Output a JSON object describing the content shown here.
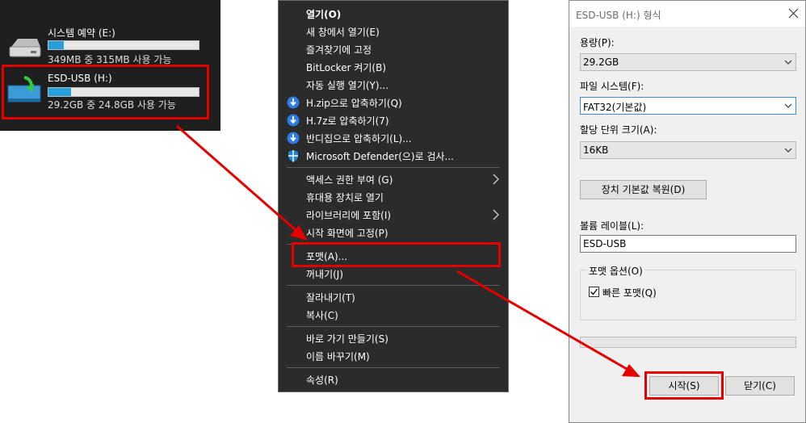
{
  "drives": [
    {
      "name": "시스템 예약 (E:)",
      "size_text": "349MB 중 315MB 사용 가능",
      "used_fraction": 0.1,
      "icon": "hard-drive-icon"
    },
    {
      "name": "ESD-USB (H:)",
      "size_text": "29.2GB 중 24.8GB 사용 가능",
      "used_fraction": 0.15,
      "icon": "usb-drive-icon"
    }
  ],
  "context_menu": {
    "items": [
      {
        "label": "열기(O)",
        "bold": true
      },
      {
        "label": "새 창에서 열기(E)"
      },
      {
        "label": "즐겨찾기에 고정"
      },
      {
        "label": "BitLocker 켜기(B)"
      },
      {
        "label": "자동 실행 열기(Y)..."
      },
      {
        "label": "H.zip으로 압축하기(Q)",
        "icon": "bandizip-icon"
      },
      {
        "label": "H.7z로 압축하기(7)",
        "icon": "bandizip-icon"
      },
      {
        "label": "반디집으로 압축하기(L)...",
        "icon": "bandizip-icon"
      },
      {
        "label": "Microsoft Defender(으)로 검사...",
        "icon": "defender-shield-icon"
      },
      {
        "label": "액세스 권한 부여 (G)",
        "submenu": true
      },
      {
        "label": "휴대용 장치로 열기"
      },
      {
        "label": "라이브러리에 포함(I)",
        "submenu": true
      },
      {
        "label": "시작 화면에 고정(P)"
      },
      {
        "label": "포맷(A)..."
      },
      {
        "label": "꺼내기(J)"
      },
      {
        "label": "잘라내기(T)"
      },
      {
        "label": "복사(C)"
      },
      {
        "label": "바로 가기 만들기(S)"
      },
      {
        "label": "이름 바꾸기(M)"
      },
      {
        "label": "속성(R)"
      }
    ]
  },
  "format_dialog": {
    "title": "ESD-USB (H:) 형식",
    "capacity_label": "용량(P):",
    "capacity_value": "29.2GB",
    "filesystem_label": "파일 시스템(F):",
    "filesystem_value": "FAT32(기본값)",
    "allocation_label": "할당 단위 크기(A):",
    "allocation_value": "16KB",
    "restore_defaults_label": "장치 기본값 복원(D)",
    "volume_label_label": "볼륨 레이블(L):",
    "volume_label_value": "ESD-USB",
    "format_options_label": "포맷 옵션(O)",
    "quick_format_label": "빠른 포맷(Q)",
    "quick_format_checked": true,
    "progress": 0,
    "start_label": "시작(S)",
    "close_label": "닫기(C)"
  },
  "colors": {
    "highlight": "#e50000",
    "drive_bar_fill": "#26a0da",
    "menu_background": "#2b2b2b"
  }
}
